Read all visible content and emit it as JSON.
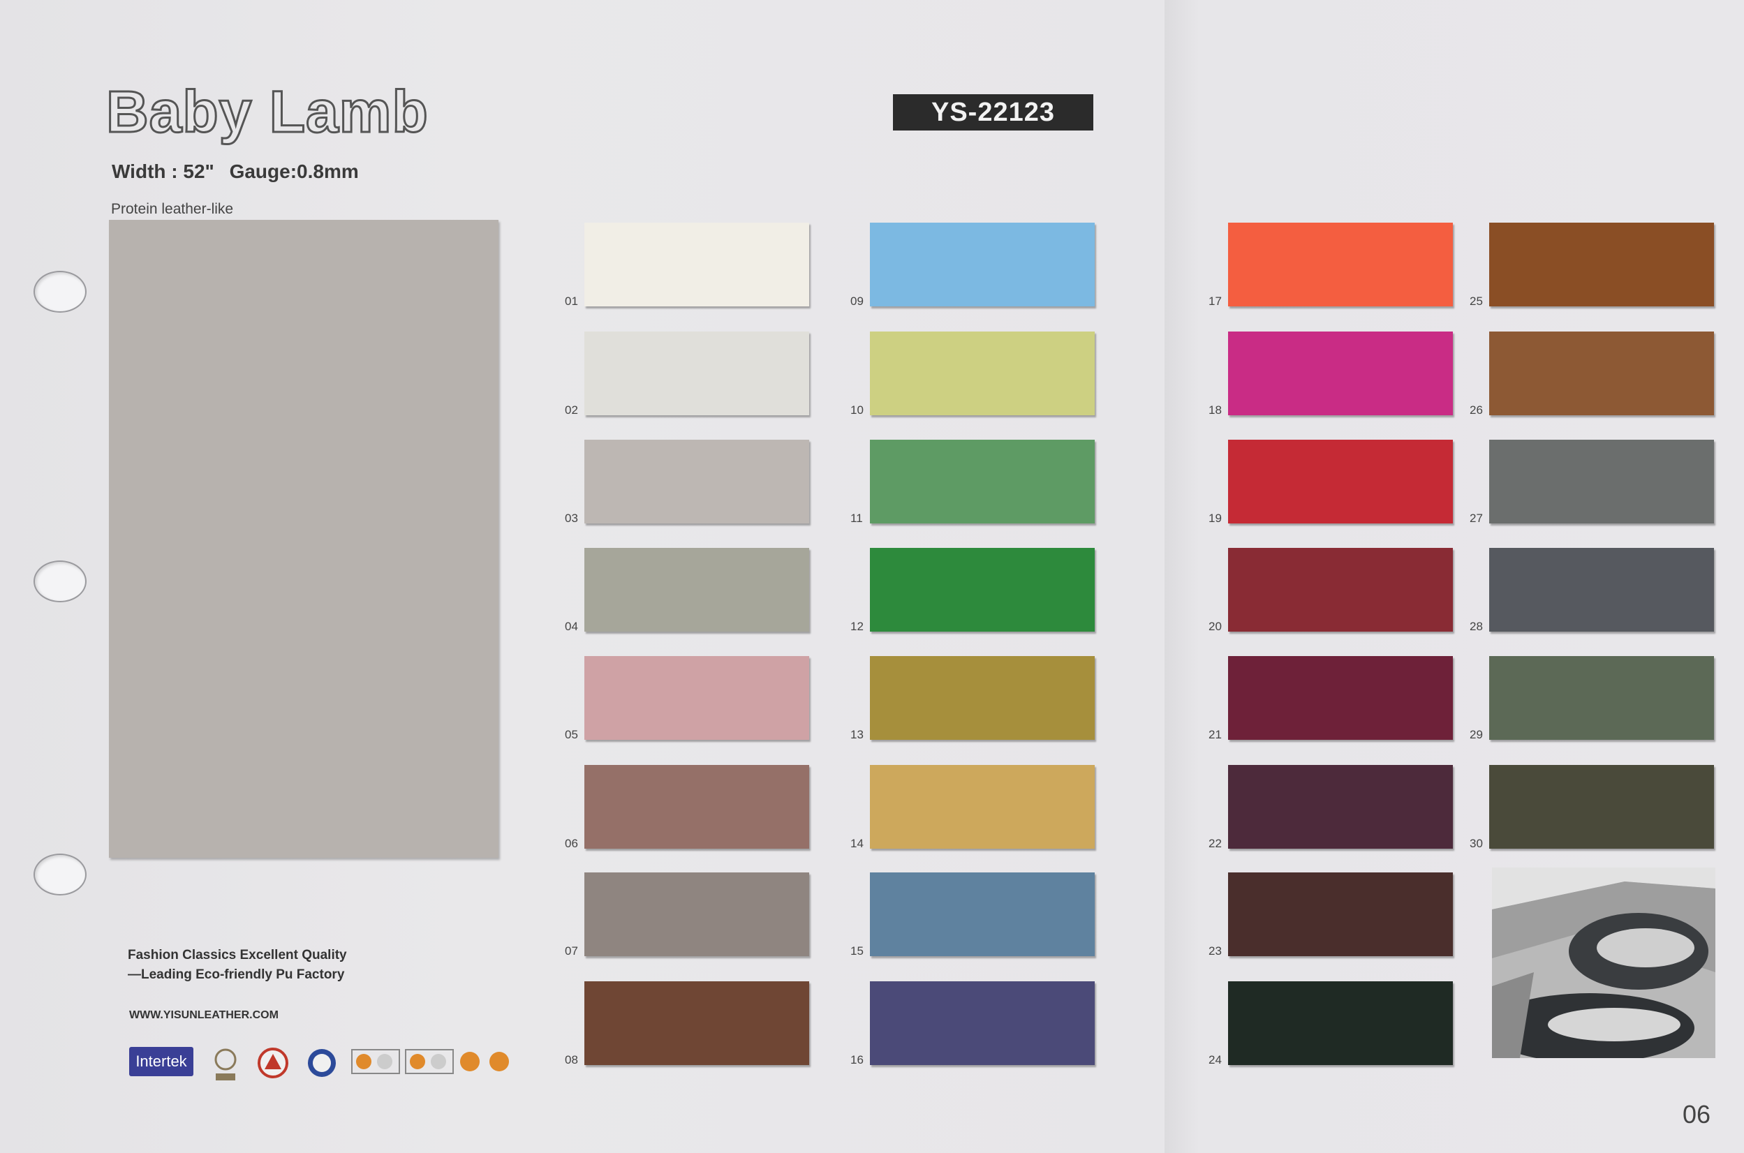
{
  "title": "Baby Lamb",
  "code": "YS-22123",
  "spec": {
    "width": "Width : 52\"",
    "gauge": "Gauge:0.8mm"
  },
  "subtitle": "Protein leather-like",
  "tagline": {
    "line1": "Fashion Classics Excellent Quality",
    "line2": "—Leading Eco-friendly Pu Factory"
  },
  "website": "WWW.YISUNLEATHER.COM",
  "certs": {
    "intertek": "Intertek"
  },
  "page_number": "06",
  "swatches": [
    {
      "num": "01",
      "color": "#f1eee6"
    },
    {
      "num": "02",
      "color": "#e0dfda"
    },
    {
      "num": "03",
      "color": "#bdb7b3"
    },
    {
      "num": "04",
      "color": "#a6a69a"
    },
    {
      "num": "05",
      "color": "#cfa2a5"
    },
    {
      "num": "06",
      "color": "#957068"
    },
    {
      "num": "07",
      "color": "#8f8580"
    },
    {
      "num": "08",
      "color": "#6f4634"
    },
    {
      "num": "09",
      "color": "#7cb9e2"
    },
    {
      "num": "10",
      "color": "#cdd082"
    },
    {
      "num": "11",
      "color": "#5e9b64"
    },
    {
      "num": "12",
      "color": "#2d8a3c"
    },
    {
      "num": "13",
      "color": "#a68f3c"
    },
    {
      "num": "14",
      "color": "#cda85c"
    },
    {
      "num": "15",
      "color": "#5f829f"
    },
    {
      "num": "16",
      "color": "#4b4a78"
    },
    {
      "num": "17",
      "color": "#f45e40"
    },
    {
      "num": "18",
      "color": "#c92c85"
    },
    {
      "num": "19",
      "color": "#c52a35"
    },
    {
      "num": "20",
      "color": "#892b34"
    },
    {
      "num": "21",
      "color": "#6e2139"
    },
    {
      "num": "22",
      "color": "#4d2a3b"
    },
    {
      "num": "23",
      "color": "#4a2e2c"
    },
    {
      "num": "24",
      "color": "#1f2a24"
    },
    {
      "num": "25",
      "color": "#8a4e25"
    },
    {
      "num": "26",
      "color": "#8d5934"
    },
    {
      "num": "27",
      "color": "#6b6e6d"
    },
    {
      "num": "28",
      "color": "#56595f"
    },
    {
      "num": "29",
      "color": "#5c6956"
    },
    {
      "num": "30",
      "color": "#4a4a3a"
    }
  ]
}
